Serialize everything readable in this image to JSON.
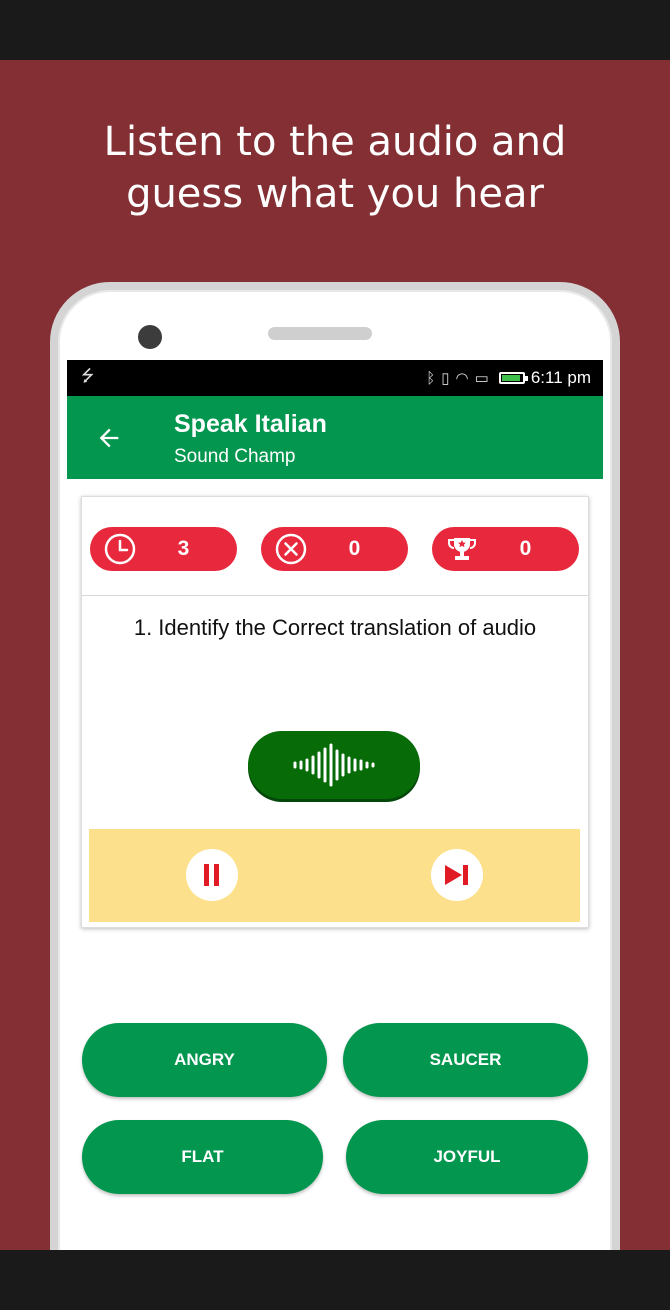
{
  "promo": {
    "headline": "Listen to the audio and\nguess what you hear"
  },
  "status_bar": {
    "time": "6:11 pm"
  },
  "app_bar": {
    "title": "Speak Italian",
    "subtitle": "Sound Champ"
  },
  "stats": {
    "timer": "3",
    "wrong": "0",
    "score": "0"
  },
  "question": {
    "text": "1. Identify the Correct translation of  audio"
  },
  "answers": [
    {
      "label": "ANGRY"
    },
    {
      "label": "SAUCER"
    },
    {
      "label": "FLAT"
    },
    {
      "label": "JOYFUL"
    }
  ],
  "colors": {
    "promo_background": "#832f33",
    "app_bar": "#03964f",
    "stat_pill": "#e8283c",
    "audio_button": "#076b08",
    "controls_panel": "#fde08c",
    "answer_button": "#03964f"
  },
  "icons": {
    "back": "arrow-left-icon",
    "timer": "clock-icon",
    "wrong": "x-circle-icon",
    "score": "trophy-icon",
    "audio": "sound-wave-icon",
    "pause": "pause-icon",
    "next": "skip-next-icon"
  }
}
